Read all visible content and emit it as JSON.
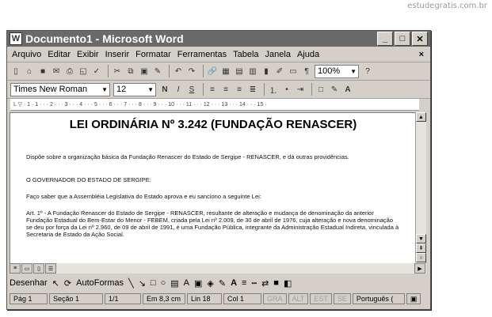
{
  "watermark": "estudegratis.com.br",
  "window": {
    "title": "Documento1 - Microsoft Word"
  },
  "menu": [
    "Arquivo",
    "Editar",
    "Exibir",
    "Inserir",
    "Formatar",
    "Ferramentas",
    "Tabela",
    "Janela",
    "Ajuda"
  ],
  "toolbar": {
    "zoom": "100%"
  },
  "format": {
    "font": "Times New Roman",
    "size": "12",
    "bold": "N",
    "italic": "I",
    "underline": "S"
  },
  "document": {
    "heading": "LEI ORDINÁRIA Nº 3.242 (FUNDAÇÃO RENASCER)",
    "p1": "Dispõe sobre a organização básica da Fundação Renascer do Estado de Sergipe - RENASCER, e dá outras providências.",
    "p2": "O GOVERNADOR DO ESTADO DE SERGIPE:",
    "p3": "Faço saber que a Assembléia Legislativa do Estado aprova e eu sanciono a seguinte Lei:",
    "p4": "Art. 1º - A Fundação Renascer do Estado de Sergipe - RENASCER, resultante de alteração e mudança de denominação da anterior Fundação Estadual do Bem-Estar do Menor - FEBEM, criada pela Lei nº 2.009, de 30 de abril de 1976, cuja alteração e nova denominação se deu por força da Lei nº 2.960, de 09 de abril de 1991, é uma Fundação Pública, integrante da Administração Estadual Indireta, vinculada à Secretaria de Estado da Ação Social."
  },
  "drawing": {
    "draw": "Desenhar",
    "autoshapes": "AutoFormas"
  },
  "status": {
    "page": "Pág 1",
    "section": "Seção 1",
    "pages": "1/1",
    "at": "Em 8,3 cm",
    "line": "Lin 18",
    "col": "Col 1",
    "rec": "GRA",
    "trk": "ALT",
    "ext": "EST",
    "ovr": "SE",
    "lang": "Português ("
  }
}
